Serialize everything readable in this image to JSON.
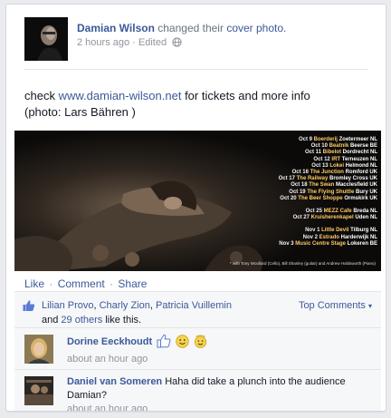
{
  "post": {
    "author": "Damian Wilson",
    "action_text": "changed their",
    "action_link": "cover photo.",
    "time": "2 hours ago",
    "separator": "·",
    "edited": "Edited",
    "privacy_icon": "globe-icon",
    "status_prefix": "check",
    "status_link": "www.damian-wilson.net",
    "status_suffix": "for tickets and more info",
    "status_line2": "(photo: Lars Bähren )"
  },
  "photo": {
    "tour_dates": [
      {
        "date": "Oct 9",
        "venue": "Boerderij",
        "place": "Zoetermeer NL"
      },
      {
        "date": "Oct 10",
        "venue": "Beatnik",
        "place": "Beerse BE"
      },
      {
        "date": "Oct 11",
        "venue": "Bibelot",
        "place": "Dordrecht NL"
      },
      {
        "date": "Oct 12",
        "venue": "IRT",
        "place": "Terneuzen NL"
      },
      {
        "date": "Oct 13",
        "venue": "Lokei",
        "place": "Helmond NL"
      },
      {
        "date": "Oct 16",
        "venue": "The Junction",
        "place": "Romford UK"
      },
      {
        "date": "Oct 17",
        "venue": "The Railway",
        "place": "Bromley Cross UK"
      },
      {
        "date": "Oct 18",
        "venue": "The Swan",
        "place": "Macclesfield UK"
      },
      {
        "date": "Oct 19",
        "venue": "The Flying Shuttle",
        "place": "Bury UK"
      },
      {
        "date": "Oct 20",
        "venue": "The Beer Shoppe",
        "place": "Ormskirk UK"
      },
      {
        "date": "Oct 25",
        "venue": "MEZZ Cafe",
        "place": "Breda NL"
      },
      {
        "date": "Oct 27",
        "venue": "Kruisherenkapel",
        "place": "Uden NL"
      },
      {
        "date": "Nov 1",
        "venue": "Little Devil",
        "place": "Tilburg NL"
      },
      {
        "date": "Nov 2",
        "venue": "Estrado",
        "place": "Harderwijk NL"
      },
      {
        "date": "Nov 3",
        "venue": "Music Centre Stage",
        "place": "Lokeren BE"
      }
    ],
    "credit": "* with Tony Woollard (Cello), Bill Shanley (guitar) and Andrew Holdsworth (Piano)"
  },
  "actions": {
    "like": "Like",
    "comment": "Comment",
    "share": "Share",
    "dot": "·"
  },
  "likes": {
    "names": [
      "Lilian Provo",
      "Charly Zion",
      "Patricia Vuillemin"
    ],
    "comma": ",",
    "and": "and",
    "others_link": "29 others",
    "suffix": "like this.",
    "top_comments": "Top Comments",
    "top_comments_caret": "▾"
  },
  "comments": [
    {
      "author": "Dorine Eeckhoudt",
      "text": "",
      "emoticons": [
        "thumbs-up-icon",
        "smile-emoticon-icon",
        "innocent-emoticon-icon"
      ],
      "time": "about an hour ago"
    },
    {
      "author": "Daniel van Someren",
      "text": "Haha did take a plunch into the audience Damian?",
      "time": "about an hour ago"
    }
  ],
  "colors": {
    "link": "#3b5998",
    "meta": "#90949c",
    "background": "#e9ebee",
    "feedback_bg": "#f6f7f9",
    "tour_venue": "#ffcc66"
  }
}
